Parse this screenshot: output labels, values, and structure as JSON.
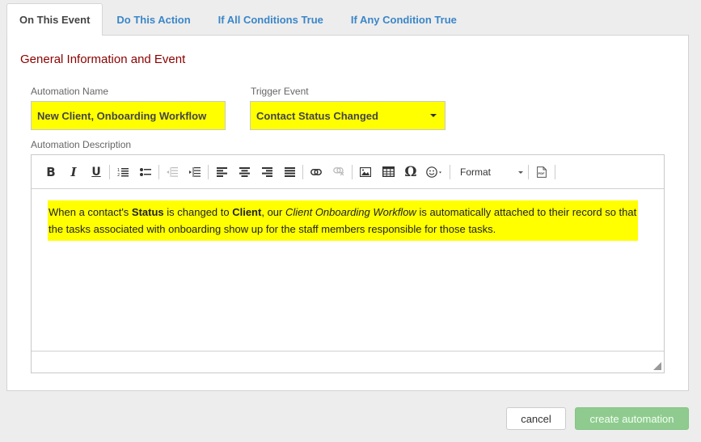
{
  "tabs": [
    {
      "label": "On This Event",
      "active": true
    },
    {
      "label": "Do This Action",
      "active": false
    },
    {
      "label": "If All Conditions True",
      "active": false
    },
    {
      "label": "If Any Condition True",
      "active": false
    }
  ],
  "section": {
    "title": "General Information and Event"
  },
  "form": {
    "automation_name": {
      "label": "Automation Name",
      "value": "New Client, Onboarding Workflow"
    },
    "trigger_event": {
      "label": "Trigger Event",
      "value": "Contact Status Changed"
    },
    "description": {
      "label": "Automation Description"
    }
  },
  "editor": {
    "toolbar": {
      "buttons": [
        "bold",
        "italic",
        "underline",
        "numbered-list",
        "bulleted-list",
        "outdent",
        "indent",
        "align-left",
        "align-center",
        "align-right",
        "justify",
        "link",
        "unlink",
        "image",
        "table",
        "special-character",
        "emoji",
        "pdf"
      ],
      "format_label": "Format"
    },
    "content": {
      "t1": "When a contact's ",
      "b1": "Status",
      "t2": " is changed to ",
      "b2": "Client",
      "t3": ", our ",
      "i1": "Client Onboarding Workflow",
      "t4": " is automatically attached to their record so that the tasks associated with onboarding show up for the staff members responsible for those tasks."
    }
  },
  "actions": {
    "cancel_label": "cancel",
    "create_label": "create automation"
  },
  "colors": {
    "highlight": "#ffff00",
    "tab_link": "#3a86c8",
    "section_title": "#8b0000",
    "create_button": "#8fcb8f"
  }
}
